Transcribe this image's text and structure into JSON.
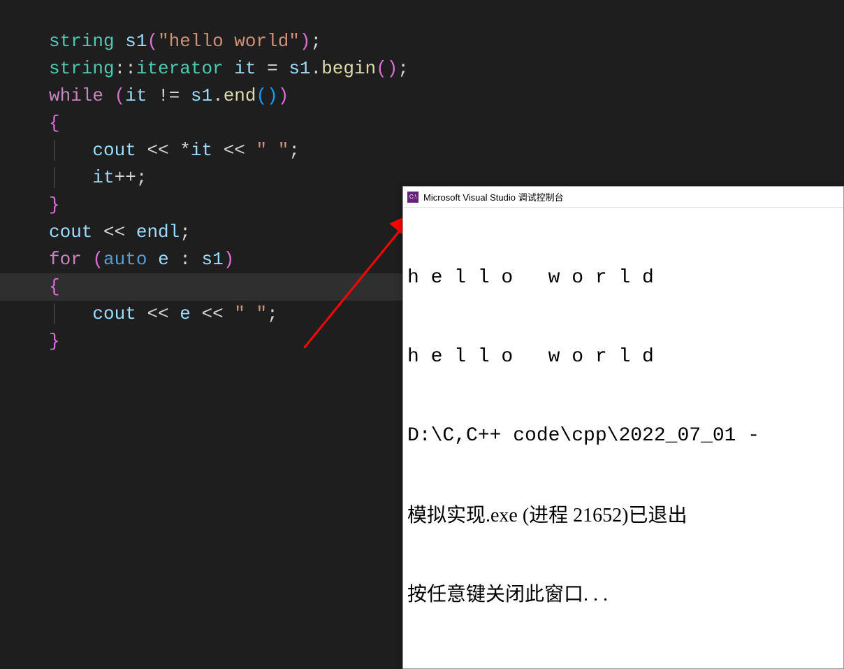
{
  "code": {
    "line1": {
      "type": "string",
      "ident": "s1",
      "parenL": "(",
      "str": "\"hello world\"",
      "parenR": ")",
      "semi": ";"
    },
    "line2": {
      "type": "string",
      "scope": "::",
      "iter": "iterator",
      "ident": "it",
      "eq": " = ",
      "var": "s1",
      "dot": ".",
      "func": "begin",
      "parenL": "(",
      "parenR": ")",
      "semi": ";"
    },
    "line3": {
      "kw": "while",
      "parenL": "(",
      "identL": "it",
      "neq": " != ",
      "identR": "s1",
      "dot": ".",
      "func": "end",
      "paren2L": "(",
      "paren2R": ")",
      "parenR": ")"
    },
    "line4": {
      "brace": "{"
    },
    "line5": {
      "obj": "cout",
      "op1": " << ",
      "deref": "*",
      "ident": "it",
      "op2": " << ",
      "str": "\" \"",
      "semi": ";"
    },
    "line6": {
      "ident": "it",
      "op": "++",
      "semi": ";"
    },
    "line7": {
      "brace": "}"
    },
    "line8": {
      "obj": "cout",
      "op": " << ",
      "endl": "endl",
      "semi": ";"
    },
    "line9": {
      "kw": "for",
      "parenL": "(",
      "auto": "auto",
      "ident": "e",
      "colon": " : ",
      "var": "s1",
      "parenR": ")"
    },
    "line10": {
      "brace": "{"
    },
    "line11": {
      "obj": "cout",
      "op1": " << ",
      "ident": "e",
      "op2": " << ",
      "str": "\" \"",
      "semi": ";"
    },
    "line12": {
      "brace": "}"
    }
  },
  "console": {
    "icon_text": "C:\\",
    "title": "Microsoft Visual Studio 调试控制台",
    "out1": "h e l l o   w o r l d",
    "out2": "h e l l o   w o r l d",
    "out3": "D:\\C,C++ code\\cpp\\2022_07_01 -",
    "out4": "模拟实现.exe (进程 21652)已退出",
    "out5": "按任意键关闭此窗口. . ."
  }
}
